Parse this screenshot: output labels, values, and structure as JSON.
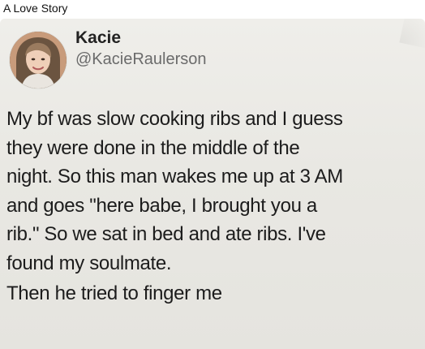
{
  "post": {
    "caption": "A Love Story"
  },
  "tweet": {
    "display_name": "Kacie",
    "handle": "@KacieRaulerson",
    "avatar": "profile-photo",
    "lines": [
      "My bf was slow cooking ribs and I guess",
      "they were done in the middle of the",
      "night. So this man wakes me up at 3 AM",
      "and goes \"here babe, I brought you a",
      "rib.\" So we sat in bed and ate ribs. I've",
      "found my soulmate.",
      "Then he tried to finger me"
    ]
  }
}
